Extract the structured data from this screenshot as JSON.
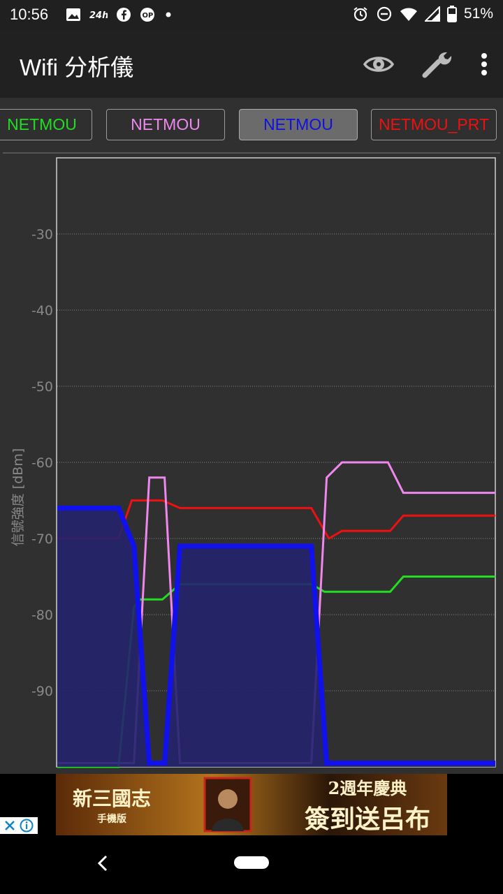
{
  "statusbar": {
    "time": "10:56",
    "left_icons": [
      "image-icon",
      "24h-icon",
      "facebook-icon",
      "op-icon",
      "dot-icon"
    ],
    "right_icons": [
      "alarm-icon",
      "dnd-icon",
      "wifi-icon",
      "signal-icon",
      "battery-icon"
    ],
    "battery": "51%"
  },
  "appbar": {
    "title": "Wifi 分析儀",
    "actions": [
      "eye-icon",
      "wrench-icon",
      "more-vert-icon"
    ]
  },
  "tabs": [
    {
      "label": "NETMOU",
      "color": "#22dd22",
      "active": false
    },
    {
      "label": "NETMOU",
      "color": "#ee88ee",
      "active": false
    },
    {
      "label": "NETMOU",
      "color": "#1111dd",
      "active": true
    },
    {
      "label": "NETMOU_PRT",
      "color": "#ee1111",
      "active": false
    }
  ],
  "chart_data": {
    "type": "line",
    "ylabel": "信號強度 [dBm]",
    "yticks": [
      -30,
      -40,
      -50,
      -60,
      -70,
      -80,
      -90
    ],
    "ylim": [
      -100,
      -20
    ],
    "xlim": [
      0,
      100
    ],
    "grid": true,
    "series": [
      {
        "color": "#ee1111",
        "width": 3,
        "fill": false,
        "points": [
          [
            0,
            -70
          ],
          [
            14,
            -70
          ],
          [
            17,
            -65
          ],
          [
            24,
            -65
          ],
          [
            28,
            -66
          ],
          [
            58,
            -66
          ],
          [
            62,
            -70
          ],
          [
            65,
            -69
          ],
          [
            76,
            -69
          ],
          [
            79,
            -67
          ],
          [
            100,
            -67
          ]
        ]
      },
      {
        "color": "#22dd22",
        "width": 3,
        "fill": false,
        "points": [
          [
            0,
            -100
          ],
          [
            14,
            -100
          ],
          [
            17.5,
            -79
          ],
          [
            19,
            -78
          ],
          [
            24,
            -78
          ],
          [
            28,
            -76
          ],
          [
            58,
            -76
          ],
          [
            61,
            -77
          ],
          [
            76,
            -77
          ],
          [
            79,
            -75
          ],
          [
            100,
            -75
          ]
        ]
      },
      {
        "color": "#ee88ee",
        "width": 3,
        "fill": false,
        "points": [
          [
            0,
            -99.5
          ],
          [
            17.5,
            -99.5
          ],
          [
            21,
            -62
          ],
          [
            24.5,
            -62
          ],
          [
            28,
            -99.5
          ],
          [
            58,
            -99.5
          ],
          [
            61.5,
            -62
          ],
          [
            65,
            -60
          ],
          [
            75.5,
            -60
          ],
          [
            79,
            -64
          ],
          [
            100,
            -64
          ]
        ]
      },
      {
        "color": "#1111ee",
        "width": 7,
        "fill": true,
        "fillColor": "rgba(35,35,110,0.9)",
        "points": [
          [
            0,
            -66
          ],
          [
            14,
            -66
          ],
          [
            17.5,
            -71
          ],
          [
            21,
            -99.5
          ],
          [
            24.5,
            -99.5
          ],
          [
            28,
            -71
          ],
          [
            58,
            -71
          ],
          [
            61.5,
            -99.5
          ],
          [
            100,
            -99.5
          ]
        ]
      }
    ]
  },
  "ad": {
    "left_text": "新三國志",
    "left_sub": "手機版",
    "line1": "2週年慶典",
    "line2": "簽到送呂布",
    "close_icon": "close-icon",
    "info_icon": "info-icon"
  },
  "navbar": {
    "back_icon": "back-icon",
    "home_icon": "home-pill-icon"
  }
}
